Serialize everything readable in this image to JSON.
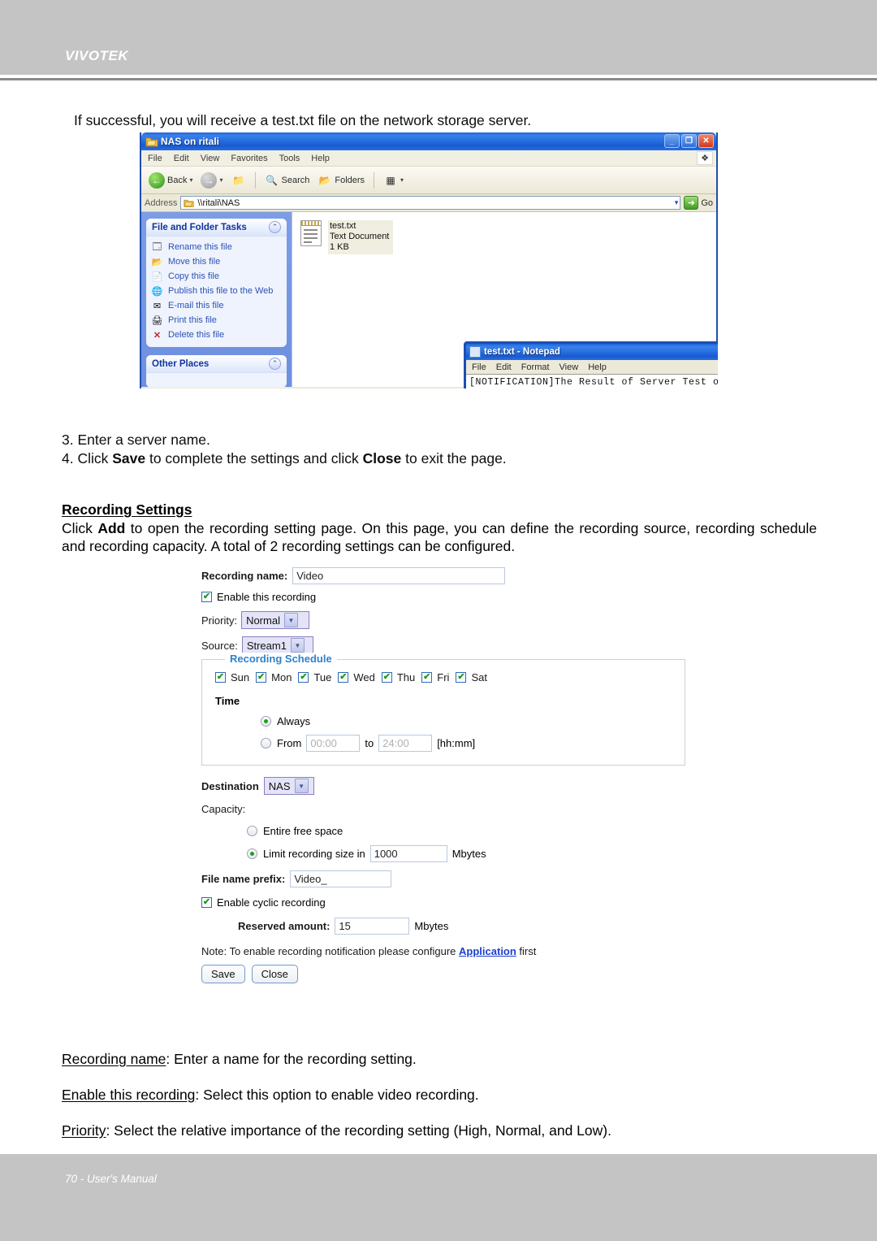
{
  "header": {
    "brand": "VIVOTEK"
  },
  "footer": {
    "page_label": "70 - User's Manual"
  },
  "intro": {
    "text": "If successful, you will receive a test.txt file on the network storage server."
  },
  "screenshot": {
    "explorer": {
      "title": "NAS on ritali",
      "menus": [
        "File",
        "Edit",
        "View",
        "Favorites",
        "Tools",
        "Help"
      ],
      "toolbar": {
        "back": "Back",
        "search": "Search",
        "folders": "Folders"
      },
      "address_label": "Address",
      "address_value": "\\\\ritali\\NAS",
      "go_label": "Go",
      "sidebar": {
        "tasks_panel_title": "File and Folder Tasks",
        "tasks": [
          "Rename this file",
          "Move this file",
          "Copy this file",
          "Publish this file to the Web",
          "E-mail this file",
          "Print this file",
          "Delete this file"
        ],
        "other_places_title": "Other Places"
      },
      "file": {
        "name": "test.txt",
        "type": "Text Document",
        "size": "1 KB"
      }
    },
    "notepad": {
      "title": "test.txt - Notepad",
      "menus": [
        "File",
        "Edit",
        "Format",
        "View",
        "Help"
      ],
      "content": "[NOTIFICATION]The Result of Server Test of Your IP Camera"
    }
  },
  "steps": {
    "step3": "3. Enter a server name.",
    "step4_a": "4. Click ",
    "step4_save": "Save",
    "step4_b": " to complete the settings and click ",
    "step4_close": "Close",
    "step4_c": " to exit the page."
  },
  "recording_section": {
    "heading": "Recording Settings",
    "para_a": "Click ",
    "para_add": "Add",
    "para_b": " to open the recording setting page. On this page, you can define the recording source, recording schedule and recording capacity. A total of 2 recording settings can be configured."
  },
  "form": {
    "recording_name_label": "Recording name:",
    "recording_name_value": "Video",
    "enable_recording_label": "Enable this recording",
    "priority_label": "Priority:",
    "priority_value": "Normal",
    "source_label": "Source:",
    "source_value": "Stream1",
    "schedule": {
      "legend": "Recording Schedule",
      "days": [
        "Sun",
        "Mon",
        "Tue",
        "Wed",
        "Thu",
        "Fri",
        "Sat"
      ],
      "time_label": "Time",
      "always_label": "Always",
      "from_label": "From",
      "from_value": "00:00",
      "to_label": "to",
      "to_value": "24:00",
      "format_hint": "[hh:mm]"
    },
    "destination_label": "Destination",
    "destination_value": "NAS",
    "capacity_label": "Capacity:",
    "entire_free_space_label": "Entire free space",
    "limit_size_label": "Limit recording size in",
    "limit_size_value": "1000",
    "limit_size_unit": "Mbytes",
    "file_prefix_label": "File name prefix:",
    "file_prefix_value": "Video_",
    "cyclic_label": "Enable cyclic recording",
    "reserved_label": "Reserved amount:",
    "reserved_value": "15",
    "reserved_unit": "Mbytes",
    "note_a": "Note: To enable recording notification please configure ",
    "note_link": "Application",
    "note_b": " first",
    "save_label": "Save",
    "close_label": "Close"
  },
  "glossary": {
    "item1_term": "Recording name",
    "item1_desc": ": Enter a name for the recording setting.",
    "item2_term": "Enable this recording",
    "item2_desc": ": Select this option to enable video recording.",
    "item3_term": "Priority",
    "item3_desc": ": Select the relative importance of the recording setting (High, Normal, and Low)."
  }
}
